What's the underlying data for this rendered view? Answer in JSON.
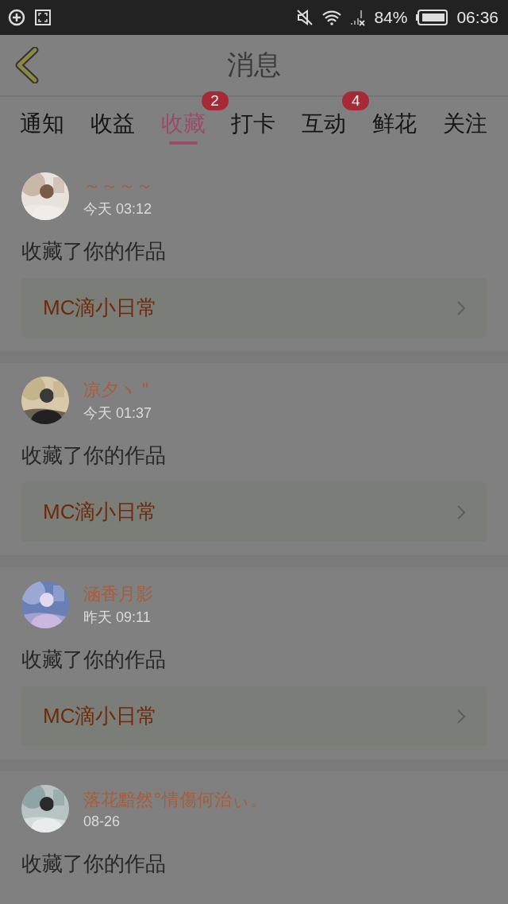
{
  "status_bar": {
    "battery": "84%",
    "time": "06:36"
  },
  "header": {
    "title": "消息"
  },
  "tabs": [
    {
      "label": "通知",
      "selected": false
    },
    {
      "label": "收益",
      "selected": false
    },
    {
      "label": "收藏",
      "selected": true,
      "badge": "2"
    },
    {
      "label": "打卡",
      "selected": false
    },
    {
      "label": "互动",
      "selected": false,
      "badge": "4"
    },
    {
      "label": "鲜花",
      "selected": false
    },
    {
      "label": "关注",
      "selected": false
    }
  ],
  "messages": [
    {
      "name": "～～～～",
      "time": "今天 03:12",
      "action": "收藏了你的作品",
      "work_title": "MC滴小日常"
    },
    {
      "name": "凉夕ヽ \"",
      "time": "今天 01:37",
      "action": "收藏了你的作品",
      "work_title": "MC滴小日常"
    },
    {
      "name": "涵香月影",
      "time": "昨天 09:11",
      "action": "收藏了你的作品",
      "work_title": "MC滴小日常"
    },
    {
      "name": "落花黯然°情傷何治ぃ。",
      "time": "08-26",
      "action": "收藏了你的作品"
    }
  ]
}
